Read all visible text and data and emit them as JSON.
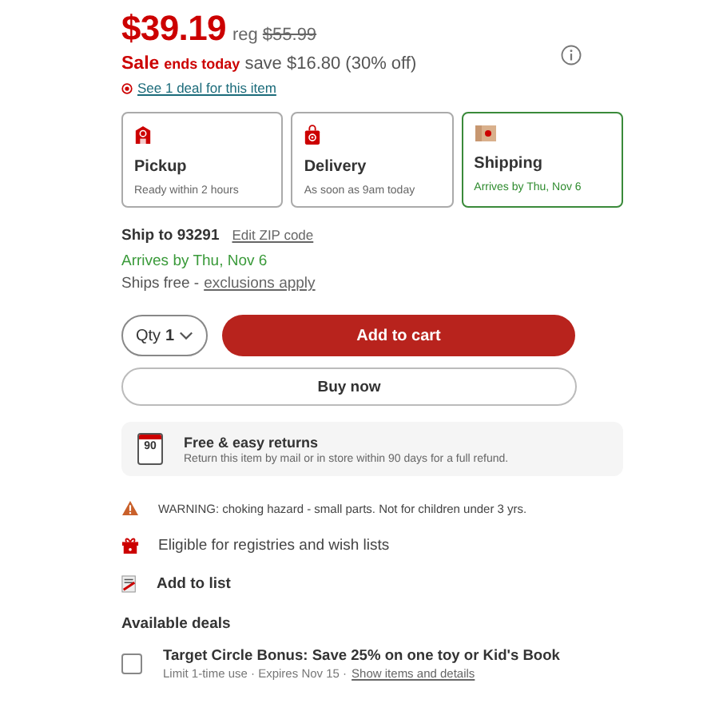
{
  "price": {
    "current": "$39.19",
    "reg_label": "reg",
    "regular": "$55.99"
  },
  "sale": {
    "label": "Sale",
    "ends": "ends today",
    "save": "save $16.80 (30% off)"
  },
  "deal_link": "See 1 deal for this item",
  "fulfillment": [
    {
      "kind": "pickup",
      "title": "Pickup",
      "subtitle": "Ready within 2 hours",
      "selected": false
    },
    {
      "kind": "delivery",
      "title": "Delivery",
      "subtitle": "As soon as 9am today",
      "selected": false
    },
    {
      "kind": "shipping",
      "title": "Shipping",
      "subtitle": "Arrives by Thu, Nov 6",
      "selected": true
    }
  ],
  "ship_to": {
    "label": "Ship to 93291",
    "edit": "Edit ZIP code"
  },
  "arrival": "Arrives by Thu, Nov 6",
  "ships_free": {
    "text": "Ships free -",
    "link": "exclusions apply"
  },
  "qty": {
    "label": "Qty",
    "value": "1"
  },
  "buttons": {
    "add_to_cart": "Add to cart",
    "buy_now": "Buy now"
  },
  "returns": {
    "badge": "90",
    "title": "Free & easy returns",
    "text": "Return this item by mail or in store within 90 days for a full refund."
  },
  "info_rows": [
    {
      "kind": "warning",
      "text": "WARNING: choking hazard - small parts. Not for children under 3 yrs."
    },
    {
      "kind": "gift",
      "text": "Eligible for registries and wish lists"
    },
    {
      "kind": "list",
      "text": "Add to list"
    }
  ],
  "deals": {
    "heading": "Available deals",
    "items": [
      {
        "title": "Target Circle Bonus: Save 25% on one toy or Kid's Book",
        "meta": "Limit 1-time use · Expires Nov 15 ·",
        "link": "Show items and details",
        "checked": false
      }
    ]
  }
}
